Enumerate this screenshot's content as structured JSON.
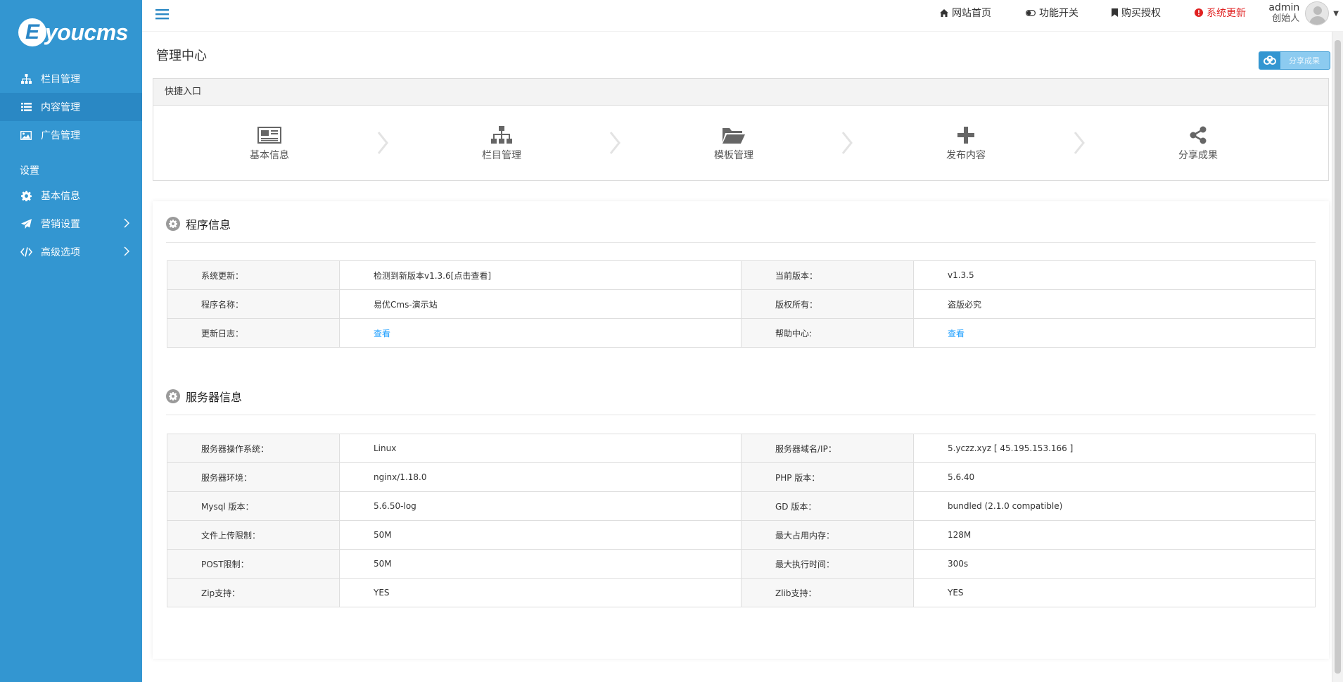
{
  "logo": {
    "mark": "E",
    "text": "youcms"
  },
  "sidebar": {
    "items": [
      {
        "label": "栏目管理",
        "icon": "sitemap-icon"
      },
      {
        "label": "内容管理",
        "icon": "list-icon"
      },
      {
        "label": "广告管理",
        "icon": "image-icon"
      }
    ],
    "section_title": "设置",
    "settings": [
      {
        "label": "基本信息",
        "icon": "gear-icon"
      },
      {
        "label": "营销设置",
        "icon": "paper-plane-icon"
      },
      {
        "label": "高级选项",
        "icon": "code-icon"
      }
    ]
  },
  "topbar": {
    "home": "网站首页",
    "toggle": "功能开关",
    "buy": "购买授权",
    "update": "系统更新",
    "user_name": "admin",
    "user_role": "创始人"
  },
  "page": {
    "title": "管理中心",
    "share_label": "分享成果"
  },
  "quick": {
    "title": "快捷入口",
    "items": [
      {
        "label": "基本信息",
        "icon": "newspaper-icon"
      },
      {
        "label": "栏目管理",
        "icon": "sitemap-icon"
      },
      {
        "label": "模板管理",
        "icon": "folder-open-icon"
      },
      {
        "label": "发布内容",
        "icon": "plus-icon"
      },
      {
        "label": "分享成果",
        "icon": "share-icon"
      }
    ]
  },
  "program": {
    "title": "程序信息",
    "rows": [
      [
        "系统更新：",
        "检测到新版本v1.3.6[点击查看]",
        "当前版本：",
        "v1.3.5"
      ],
      [
        "程序名称：",
        "易优Cms-演示站",
        "版权所有：",
        "盗版必究"
      ],
      [
        "更新日志：",
        "查看",
        "帮助中心:",
        "查看"
      ]
    ]
  },
  "server": {
    "title": "服务器信息",
    "rows": [
      [
        "服务器操作系统：",
        "Linux",
        "服务器域名/IP：",
        "5.yczz.xyz [ 45.195.153.166 ]"
      ],
      [
        "服务器环境：",
        "nginx/1.18.0",
        "PHP 版本：",
        "5.6.40"
      ],
      [
        "Mysql 版本：",
        "5.6.50-log",
        "GD 版本：",
        "bundled (2.1.0 compatible)"
      ],
      [
        "文件上传限制：",
        "50M",
        "最大占用内存：",
        "128M"
      ],
      [
        "POST限制：",
        "50M",
        "最大执行时间：",
        "300s"
      ],
      [
        "Zip支持：",
        "YES",
        "Zlib支持：",
        "YES"
      ]
    ]
  },
  "colors": {
    "sidebar": "#3396d1",
    "sidebar_active": "#2a88c4",
    "alert_red": "#e02020",
    "link_blue": "#1e9fff"
  }
}
